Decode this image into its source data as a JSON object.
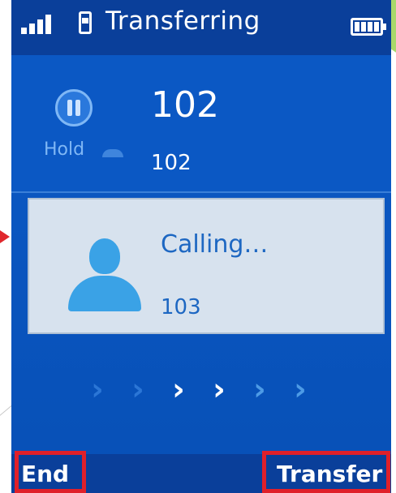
{
  "status_bar": {
    "title": "Transferring",
    "signal_icon": "signal-bars-icon",
    "line_icon": "handset-icon",
    "battery_icon": "battery-icon"
  },
  "held_call": {
    "hold_label": "Hold",
    "name": "102",
    "number": "102"
  },
  "active_call": {
    "status": "Calling…",
    "number": "103"
  },
  "softkeys": {
    "left": "End",
    "right": "Transfer"
  },
  "colors": {
    "screen_blue": "#0b58c4",
    "panel_light": "#d7e2ee",
    "highlight_red": "#e0202a",
    "accent_green": "#a8d86a"
  }
}
